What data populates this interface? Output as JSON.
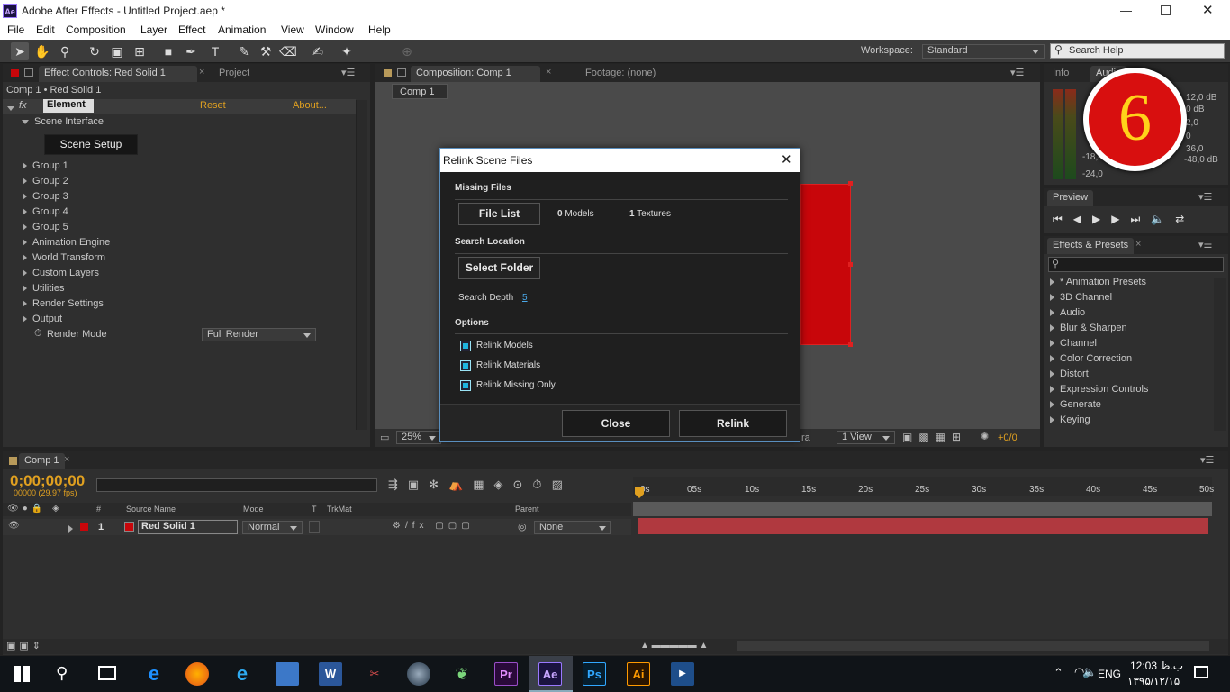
{
  "app": {
    "title": "Adobe After Effects - Untitled Project.aep *",
    "icon": "Ae"
  },
  "menu": [
    "File",
    "Edit",
    "Composition",
    "Layer",
    "Effect",
    "Animation",
    "View",
    "Window",
    "Help"
  ],
  "toolbar": {
    "workspace_label": "Workspace:",
    "workspace_value": "Standard",
    "search_placeholder": "Search Help"
  },
  "effect_controls": {
    "tab_label": "Effect Controls: Red Solid 1",
    "project_tab": "Project",
    "breadcrumb": "Comp 1 • Red Solid 1",
    "effect_name": "Element",
    "reset": "Reset",
    "about": "About...",
    "scene_interface": "Scene Interface",
    "scene_setup": "Scene Setup",
    "groups": [
      "Group 1",
      "Group 2",
      "Group 3",
      "Group 4",
      "Group 5",
      "Animation Engine",
      "World Transform",
      "Custom Layers",
      "Utilities",
      "Render Settings",
      "Output"
    ],
    "render_mode_label": "Render Mode",
    "render_mode_value": "Full Render"
  },
  "composition": {
    "tab_label": "Composition: Comp 1",
    "footage_tab": "Footage: (none)",
    "comp_button": "Comp 1",
    "zoom": "25%",
    "view": "1 View",
    "camera_partial": "ra",
    "offset": "+0/0"
  },
  "dialog": {
    "title": "Relink Scene Files",
    "missing_files": "Missing Files",
    "file_list": "File List",
    "models_count": "0",
    "models_label": "Models",
    "textures_count": "1",
    "textures_label": "Textures",
    "search_location": "Search Location",
    "select_folder": "Select Folder",
    "search_depth_label": "Search Depth",
    "search_depth_value": "5",
    "options": "Options",
    "opt1": "Relink Models",
    "opt2": "Relink Materials",
    "opt3": "Relink Missing Only",
    "close": "Close",
    "relink": "Relink"
  },
  "audio": {
    "info_tab": "Info",
    "audio_tab": "Audio",
    "left_labels": [
      "-18,0",
      "-24,0"
    ],
    "right_labels": [
      "12,0 dB",
      "0 dB",
      "2,0",
      "0",
      "36,0",
      "-48,0 dB"
    ],
    "badge": "6"
  },
  "preview": {
    "tab": "Preview"
  },
  "effects": {
    "tab": "Effects & Presets",
    "items": [
      "* Animation Presets",
      "3D Channel",
      "Audio",
      "Blur & Sharpen",
      "Channel",
      "Color Correction",
      "Distort",
      "Expression Controls",
      "Generate",
      "Keying"
    ]
  },
  "timeline": {
    "tab": "Comp 1",
    "timecode": "0;00;00;00",
    "fps": "00000 (29.97 fps)",
    "col_source": "Source Name",
    "col_mode": "Mode",
    "col_t": "T",
    "col_trkmat": "TrkMat",
    "col_parent": "Parent",
    "col_num": "#",
    "layer_num": "1",
    "layer_name": "Red Solid 1",
    "layer_mode": "Normal",
    "layer_parent": "None",
    "ruler": [
      "0s",
      "05s",
      "10s",
      "15s",
      "20s",
      "25s",
      "30s",
      "35s",
      "40s",
      "45s",
      "50s"
    ]
  },
  "taskbar": {
    "lang": "ENG",
    "time": "12:03 ب.ظ",
    "date": "۱۳۹۵/۱۲/۱۵",
    "apps": [
      "Pr",
      "Ae",
      "Ps",
      "Ai"
    ]
  },
  "colors": {
    "red_solid": "#c8060a",
    "accent_orange": "#e0a020",
    "dialog_bg": "#1f1f1f"
  }
}
